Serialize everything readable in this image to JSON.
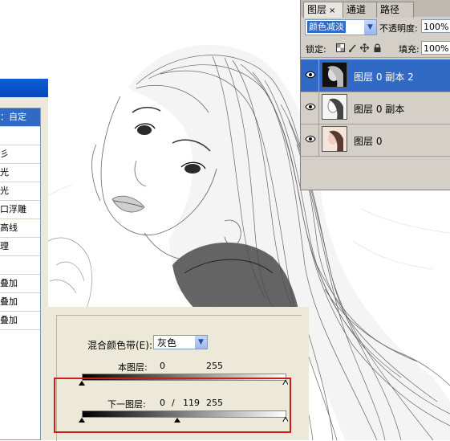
{
  "layers_panel": {
    "tabs": [
      {
        "label": "图层",
        "close": "×"
      },
      {
        "label": "通道"
      },
      {
        "label": "路径"
      }
    ],
    "blend_mode": "颜色减淡",
    "opacity_label": "不透明度:",
    "opacity_value": "100%",
    "lock_label": "锁定:",
    "fill_label": "填充:",
    "fill_value": "100%",
    "layers": [
      {
        "name": "图层 0 副本 2",
        "selected": true
      },
      {
        "name": "图层 0 副本",
        "selected": false
      },
      {
        "name": "图层 0",
        "selected": false
      }
    ]
  },
  "style_dialog": {
    "items": [
      "：自定",
      "",
      "彡",
      "光",
      "光",
      "口浮雕",
      "高线",
      "理",
      "",
      "叠加",
      "叠加",
      "叠加"
    ]
  },
  "blend_if": {
    "label": "混合颜色带(E):",
    "channel": "灰色",
    "this_layer_label": "本图层:",
    "this_layer_low": "0",
    "this_layer_high": "255",
    "underlying_label": "下一图层:",
    "underlying_low": "0",
    "underlying_slash": "/",
    "underlying_mid": "119",
    "underlying_high": "255",
    "this_layer_black_point": 0,
    "this_layer_white_point": 255,
    "underlying_black_point": 0,
    "underlying_split_point": 119,
    "underlying_white_point": 255
  }
}
